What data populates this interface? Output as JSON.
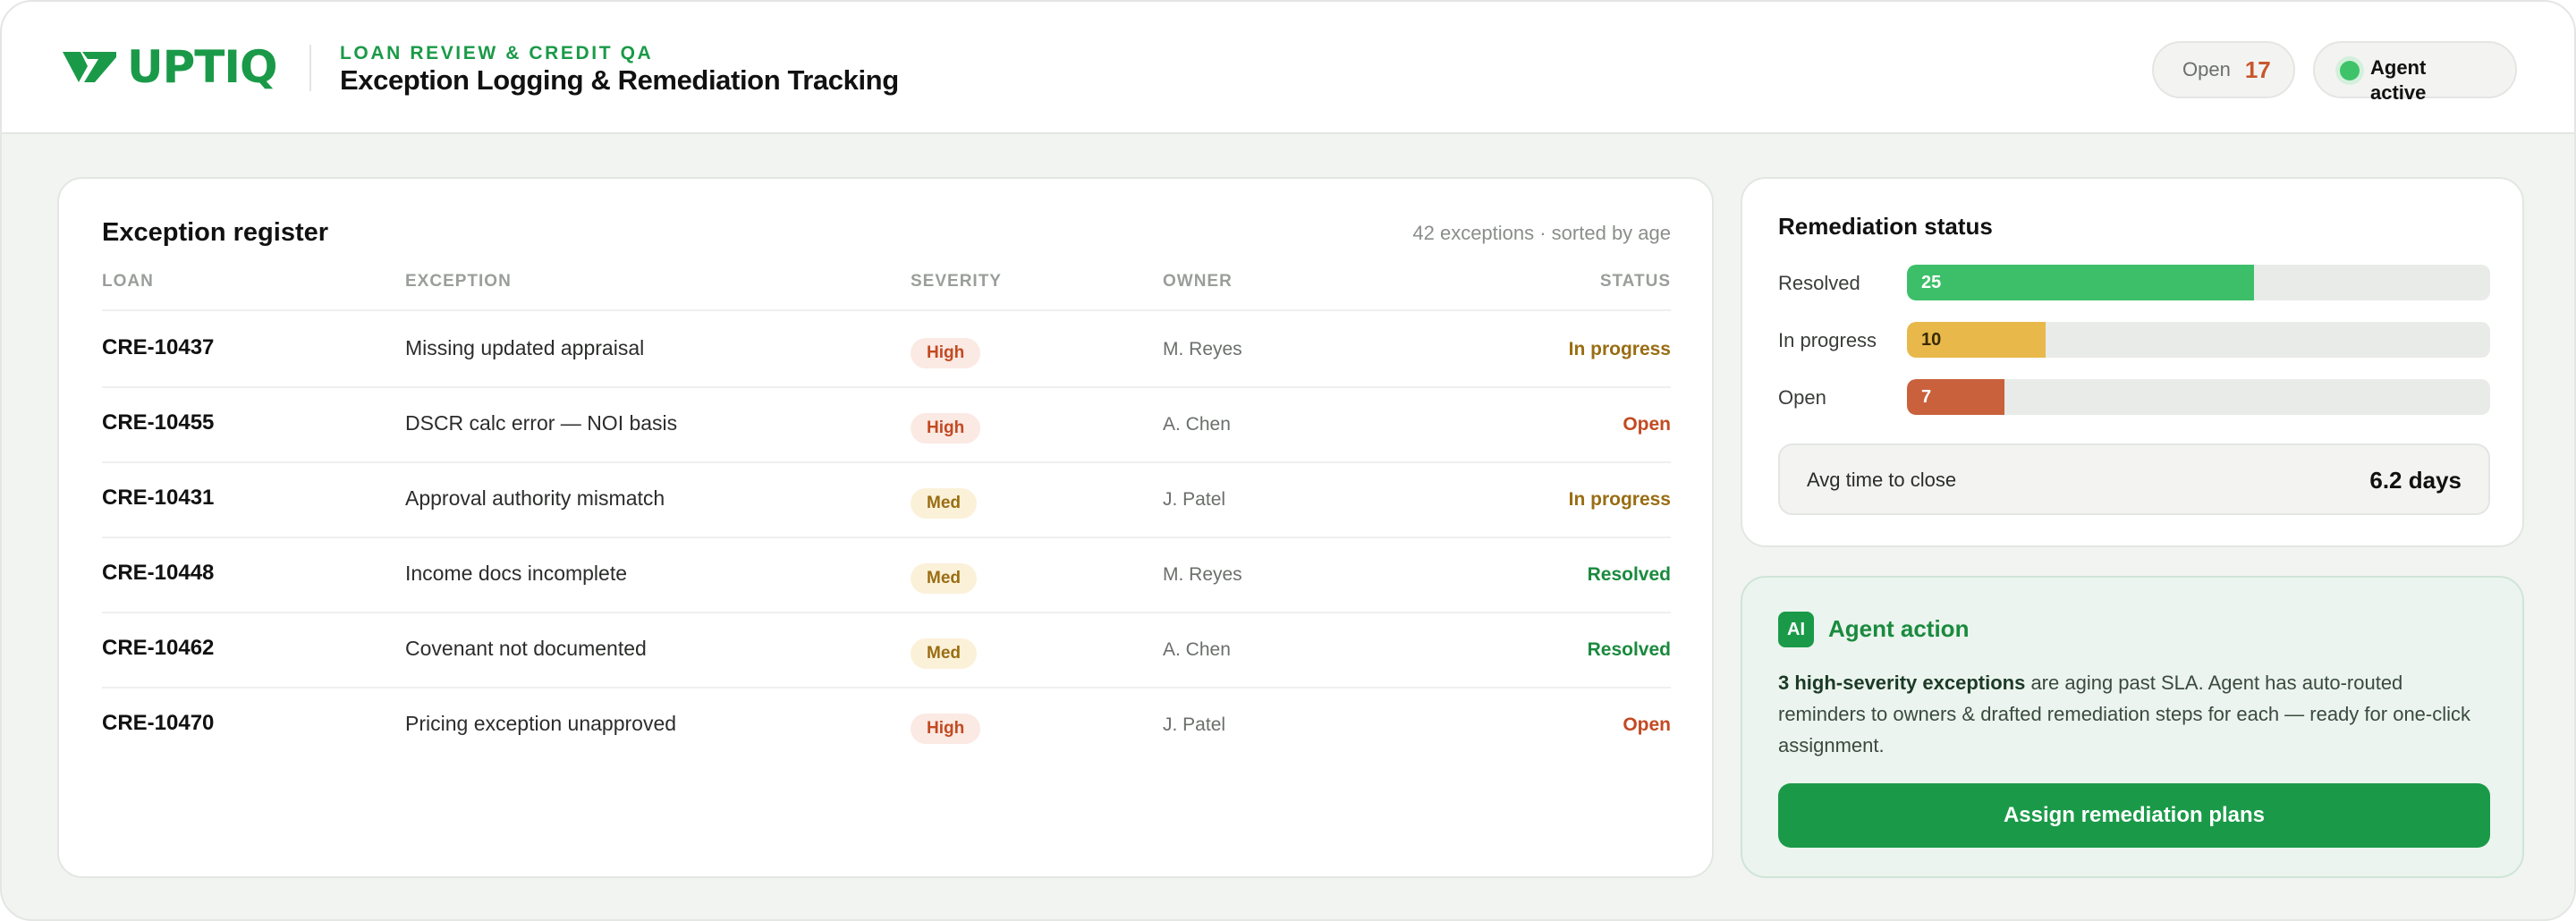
{
  "brand": {
    "name": "UPTIQ",
    "color": "#1a9a48"
  },
  "header": {
    "eyebrow": "LOAN REVIEW & CREDIT QA",
    "title": "Exception Logging & Remediation Tracking",
    "open_label": "Open",
    "open_count": "17",
    "agent_status": "Agent active"
  },
  "register": {
    "title": "Exception register",
    "meta": "42 exceptions · sorted by age",
    "columns": {
      "loan": "LOAN",
      "exception": "EXCEPTION",
      "severity": "SEVERITY",
      "owner": "OWNER",
      "status": "STATUS"
    },
    "rows": [
      {
        "loan": "CRE-10437",
        "exception": "Missing updated appraisal",
        "severity": "High",
        "owner": "M. Reyes",
        "status": "In progress"
      },
      {
        "loan": "CRE-10455",
        "exception": "DSCR calc error — NOI basis",
        "severity": "High",
        "owner": "A. Chen",
        "status": "Open"
      },
      {
        "loan": "CRE-10431",
        "exception": "Approval authority mismatch",
        "severity": "Med",
        "owner": "J. Patel",
        "status": "In progress"
      },
      {
        "loan": "CRE-10448",
        "exception": "Income docs incomplete",
        "severity": "Med",
        "owner": "M. Reyes",
        "status": "Resolved"
      },
      {
        "loan": "CRE-10462",
        "exception": "Covenant not documented",
        "severity": "Med",
        "owner": "A. Chen",
        "status": "Resolved"
      },
      {
        "loan": "CRE-10470",
        "exception": "Pricing exception unapproved",
        "severity": "High",
        "owner": "J. Patel",
        "status": "Open"
      }
    ]
  },
  "remediation": {
    "title": "Remediation status",
    "scale_max": 42,
    "bars": [
      {
        "label": "Resolved",
        "value": 25,
        "color": "#3cbf68",
        "text_color": "#ffffff"
      },
      {
        "label": "In progress",
        "value": 10,
        "color": "#e8b94a",
        "text_color": "#3a2a05"
      },
      {
        "label": "Open",
        "value": 7,
        "color": "#c8613c",
        "text_color": "#ffffff"
      }
    ],
    "avg_label": "Avg time to close",
    "avg_value": "6.2 days"
  },
  "agent": {
    "badge": "AI",
    "title": "Agent action",
    "body_strong": "3 high-severity exceptions",
    "body_rest": " are aging past SLA. Agent has auto-routed reminders to owners & drafted remediation steps for each — ready for one-click assignment.",
    "button": "Assign remediation plans"
  }
}
